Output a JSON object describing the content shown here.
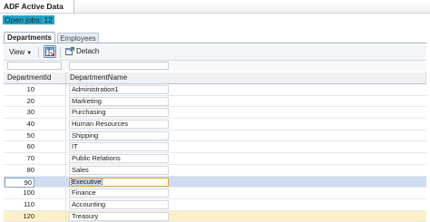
{
  "app": {
    "title": "ADF Active Data"
  },
  "status": {
    "open_jobs": "Open jobs: 12"
  },
  "tabs": [
    {
      "label": "Departments",
      "active": true
    },
    {
      "label": "Employees",
      "active": false
    }
  ],
  "toolbar": {
    "view_label": "View",
    "detach_label": "Detach",
    "icons": [
      "freeze-icon",
      "detach-icon"
    ]
  },
  "table": {
    "columns": [
      "DepartmentId",
      "DepartmentName"
    ],
    "rows": [
      {
        "id": "10",
        "name": "Administration1"
      },
      {
        "id": "20",
        "name": "Marketing"
      },
      {
        "id": "30",
        "name": "Purchasing"
      },
      {
        "id": "40",
        "name": "Human Resources"
      },
      {
        "id": "50",
        "name": "Shipping"
      },
      {
        "id": "60",
        "name": "IT"
      },
      {
        "id": "70",
        "name": "Public Relations"
      },
      {
        "id": "80",
        "name": "Sales"
      },
      {
        "id": "90",
        "name": "Executive"
      },
      {
        "id": "100",
        "name": "Finance"
      },
      {
        "id": "110",
        "name": "Accounting"
      },
      {
        "id": "120",
        "name": "Treasury"
      }
    ],
    "selected_row": 8,
    "highlighted_row": 11
  },
  "colors": {
    "open_jobs_bg": "#24a6c8",
    "selected_row": "#cfdcf1",
    "highlighted_row": "#fdf0c8"
  }
}
